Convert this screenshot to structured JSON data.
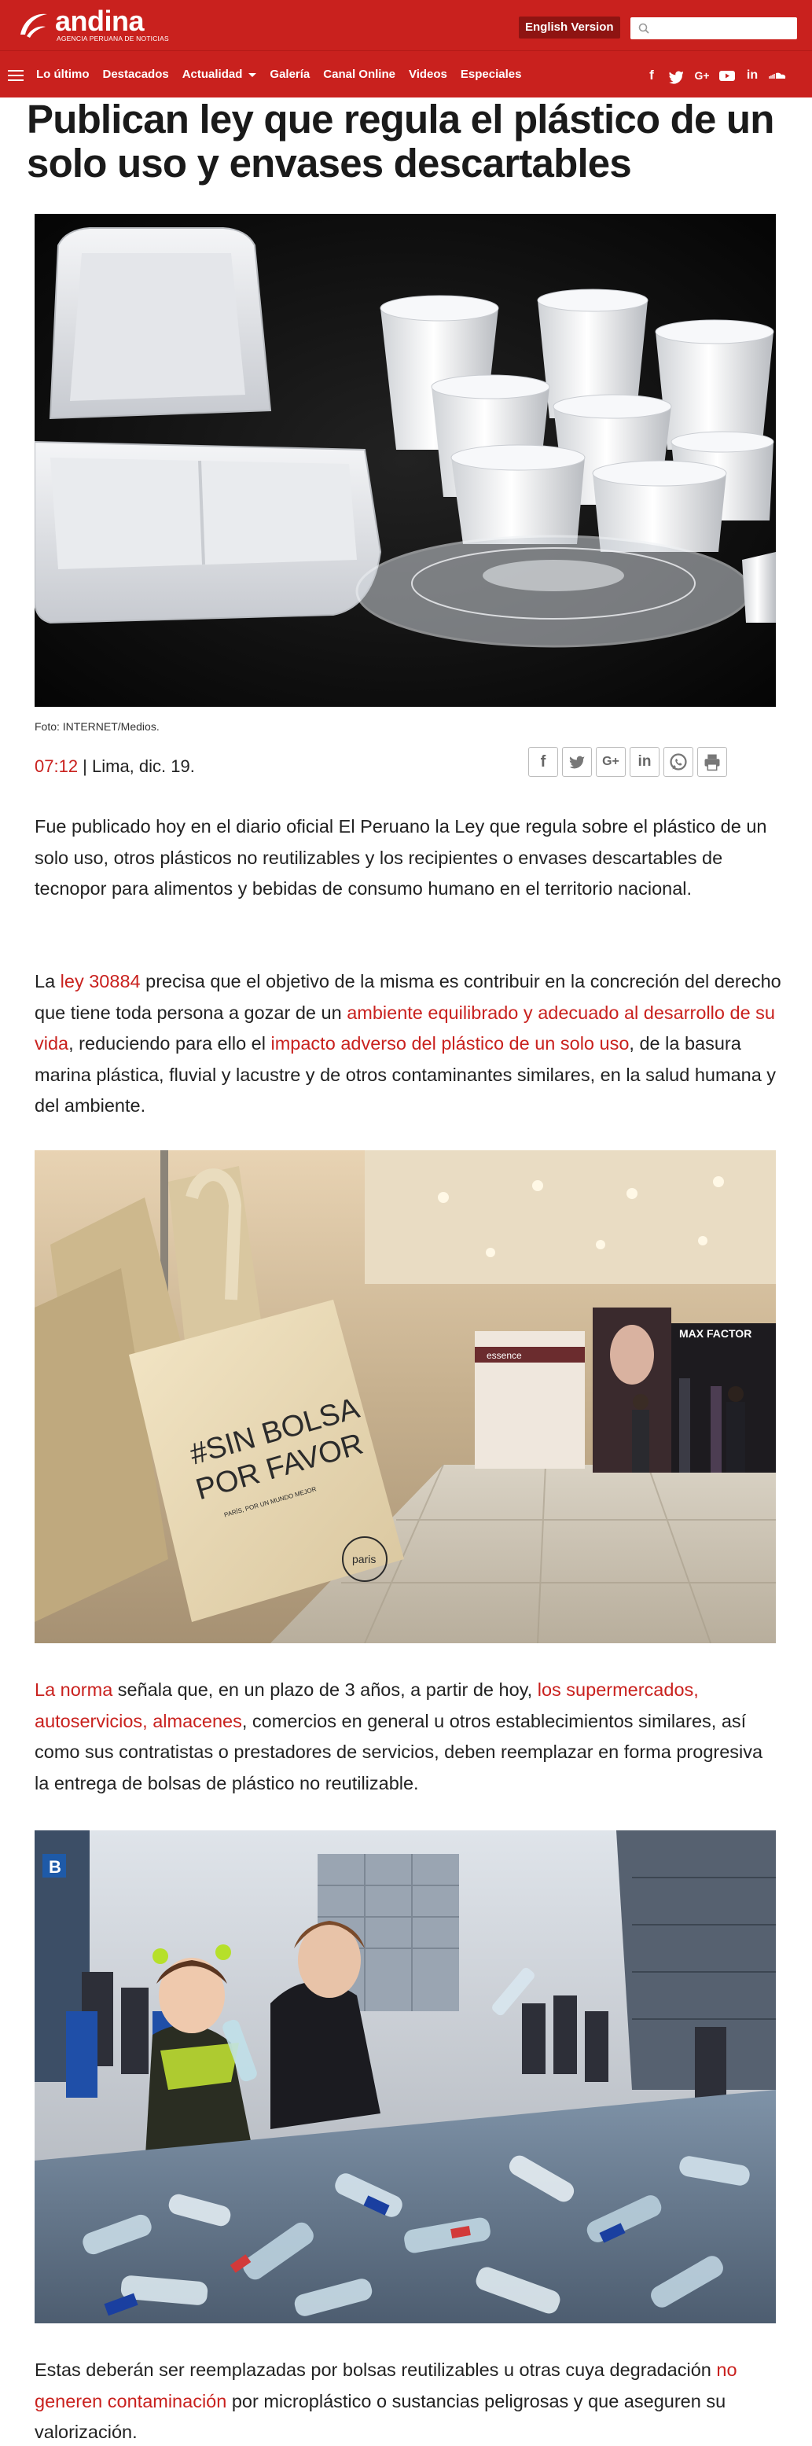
{
  "header": {
    "logo_name": "andina",
    "logo_tagline": "AGENCIA PERUANA DE NOTICIAS",
    "english_label": "English Version",
    "search_placeholder": ""
  },
  "nav": {
    "items": [
      {
        "label": "Lo último"
      },
      {
        "label": "Destacados"
      },
      {
        "label": "Actualidad"
      },
      {
        "label": "Galería"
      },
      {
        "label": "Canal Online"
      },
      {
        "label": "Videos"
      },
      {
        "label": "Especiales"
      }
    ],
    "social": [
      "facebook-icon",
      "twitter-icon",
      "google-plus-icon",
      "youtube-icon",
      "linkedin-icon",
      "soundcloud-icon"
    ]
  },
  "article": {
    "title": "Publican ley que regula el plástico de un solo uso y envases descartables",
    "photo_credit": "Foto: INTERNET/Medios.",
    "time": "07:12",
    "dateline_rest": " | Lima, dic. 19.",
    "share_icons": [
      "facebook-icon",
      "twitter-icon",
      "google-plus-icon",
      "linkedin-icon",
      "whatsapp-icon",
      "print-icon"
    ],
    "p1": "Fue publicado hoy en el diario oficial El Peruano la Ley que regula sobre el plástico de un solo uso, otros plásticos no reutilizables y los recipientes o envases descartables de tecnopor para alimentos y bebidas de consumo humano en el territorio nacional.",
    "p2": {
      "t1": "La ",
      "l1": "ley 30884",
      "t2": " precisa que el objetivo de la misma es contribuir en la concreción del derecho que tiene toda persona a gozar de un ",
      "l2": "ambiente equilibrado y adecuado al desarrollo de su vida",
      "t3": ", reduciendo para ello el ",
      "l3": "impacto adverso del plástico de un solo uso",
      "t4": ", de la basura marina plástica, fluvial y lacustre y de otros contaminantes similares, en la salud humana y del ambiente."
    },
    "bag_text_line1": "#SIN BOLSA",
    "bag_text_line2": "POR FAVOR",
    "bag_small_text": "PARÍS, POR UN MUNDO MEJOR",
    "bag_logo": "paris",
    "store_sign1": "essence",
    "store_sign2": "MAX FACTOR",
    "p3": {
      "l1": "La norma",
      "t1": " señala que, en un plazo de 3 años, a partir de hoy, ",
      "l2": "los supermercados, autoservicios, almacenes",
      "t2": ", comercios en general u otros establecimientos similares, así como sus contratistas o prestadores de servicios, deben reemplazar en forma progresiva la entrega de bolsas de plástico no reutilizable."
    },
    "photo3_sign": "B",
    "p4": {
      "t1": "Estas deberán ser reemplazadas por bolsas reutilizables u otras cuya degradación ",
      "l1": "no generen contaminación",
      "t2": " por microplástico o sustancias peligrosas y que aseguren su valorización."
    }
  }
}
